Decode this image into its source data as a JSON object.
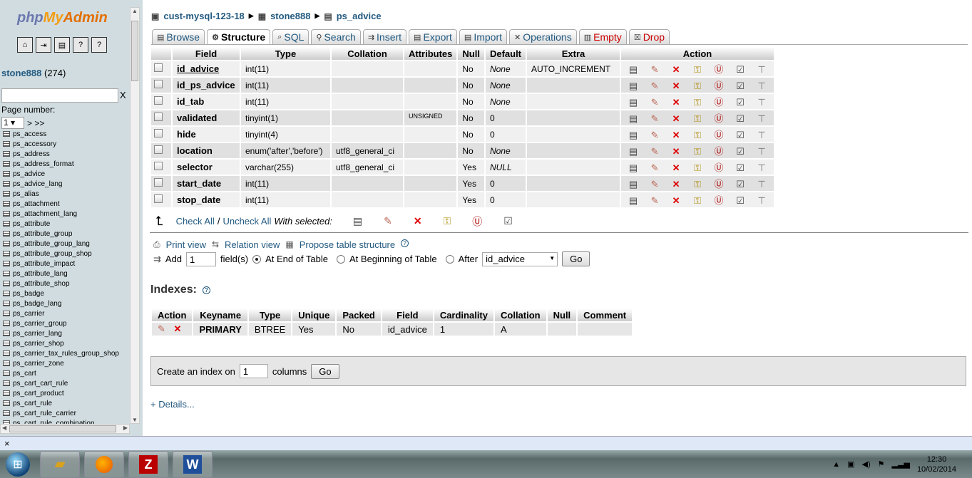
{
  "sidebar": {
    "logo": {
      "php": "php",
      "my": "My",
      "admin": "Admin"
    },
    "icons": [
      "home-icon",
      "exit-icon",
      "sql-icon",
      "docs-icon",
      "help-icon"
    ],
    "db_name": "stone888",
    "db_count": "(274)",
    "search_clear": "X",
    "page_number_label": "Page number:",
    "page_value": "1",
    "page_next": "> >>",
    "tables": [
      "ps_access",
      "ps_accessory",
      "ps_address",
      "ps_address_format",
      "ps_advice",
      "ps_advice_lang",
      "ps_alias",
      "ps_attachment",
      "ps_attachment_lang",
      "ps_attribute",
      "ps_attribute_group",
      "ps_attribute_group_lang",
      "ps_attribute_group_shop",
      "ps_attribute_impact",
      "ps_attribute_lang",
      "ps_attribute_shop",
      "ps_badge",
      "ps_badge_lang",
      "ps_carrier",
      "ps_carrier_group",
      "ps_carrier_lang",
      "ps_carrier_shop",
      "ps_carrier_tax_rules_group_shop",
      "ps_carrier_zone",
      "ps_cart",
      "ps_cart_cart_rule",
      "ps_cart_product",
      "ps_cart_rule",
      "ps_cart_rule_carrier",
      "ps_cart_rule_combination"
    ]
  },
  "breadcrumb": {
    "server": "cust-mysql-123-18",
    "database": "stone888",
    "table": "ps_advice"
  },
  "tabs": [
    {
      "label": "Browse",
      "icon": "browse-icon"
    },
    {
      "label": "Structure",
      "icon": "structure-icon"
    },
    {
      "label": "SQL",
      "icon": "sql-icon"
    },
    {
      "label": "Search",
      "icon": "search-icon"
    },
    {
      "label": "Insert",
      "icon": "insert-icon"
    },
    {
      "label": "Export",
      "icon": "export-icon"
    },
    {
      "label": "Import",
      "icon": "import-icon"
    },
    {
      "label": "Operations",
      "icon": "operations-icon"
    },
    {
      "label": "Empty",
      "icon": "empty-icon"
    },
    {
      "label": "Drop",
      "icon": "drop-icon"
    }
  ],
  "structure": {
    "headers": {
      "field": "Field",
      "type": "Type",
      "collation": "Collation",
      "attributes": "Attributes",
      "null": "Null",
      "default": "Default",
      "extra": "Extra",
      "action": "Action"
    },
    "rows": [
      {
        "field": "id_advice",
        "type": "int(11)",
        "collation": "",
        "attributes": "",
        "null": "No",
        "default": "None",
        "extra": "AUTO_INCREMENT"
      },
      {
        "field": "id_ps_advice",
        "type": "int(11)",
        "collation": "",
        "attributes": "",
        "null": "No",
        "default": "None",
        "extra": ""
      },
      {
        "field": "id_tab",
        "type": "int(11)",
        "collation": "",
        "attributes": "",
        "null": "No",
        "default": "None",
        "extra": ""
      },
      {
        "field": "validated",
        "type": "tinyint(1)",
        "collation": "",
        "attributes": "UNSIGNED",
        "null": "No",
        "default": "0",
        "extra": ""
      },
      {
        "field": "hide",
        "type": "tinyint(4)",
        "collation": "",
        "attributes": "",
        "null": "No",
        "default": "0",
        "extra": ""
      },
      {
        "field": "location",
        "type": "enum('after','before')",
        "collation": "utf8_general_ci",
        "attributes": "",
        "null": "No",
        "default": "None",
        "extra": ""
      },
      {
        "field": "selector",
        "type": "varchar(255)",
        "collation": "utf8_general_ci",
        "attributes": "",
        "null": "Yes",
        "default": "NULL",
        "extra": ""
      },
      {
        "field": "start_date",
        "type": "int(11)",
        "collation": "",
        "attributes": "",
        "null": "Yes",
        "default": "0",
        "extra": ""
      },
      {
        "field": "stop_date",
        "type": "int(11)",
        "collation": "",
        "attributes": "",
        "null": "Yes",
        "default": "0",
        "extra": ""
      }
    ]
  },
  "with_selected": {
    "check_all": "Check All",
    "separator": "/",
    "uncheck_all": "Uncheck All",
    "label": "With selected:"
  },
  "links": {
    "print_view": "Print view",
    "relation_view": "Relation view",
    "propose": "Propose table structure"
  },
  "add_field": {
    "label": "Add",
    "value": "1",
    "fields_label": "field(s)",
    "end": "At End of Table",
    "beginning": "At Beginning of Table",
    "after": "After",
    "after_value": "id_advice",
    "go": "Go"
  },
  "indexes": {
    "title": "Indexes:",
    "headers": [
      "Action",
      "Keyname",
      "Type",
      "Unique",
      "Packed",
      "Field",
      "Cardinality",
      "Collation",
      "Null",
      "Comment"
    ],
    "rows": [
      {
        "keyname": "PRIMARY",
        "type": "BTREE",
        "unique": "Yes",
        "packed": "No",
        "field": "id_advice",
        "cardinality": "1",
        "collation": "A",
        "null": "",
        "comment": ""
      }
    ]
  },
  "create_index": {
    "label": "Create an index on",
    "value": "1",
    "columns": "columns",
    "go": "Go"
  },
  "details": "+ Details...",
  "bottombar": {
    "close": "×"
  },
  "taskbar": {
    "time": "12:30",
    "date": "10/02/2014"
  }
}
